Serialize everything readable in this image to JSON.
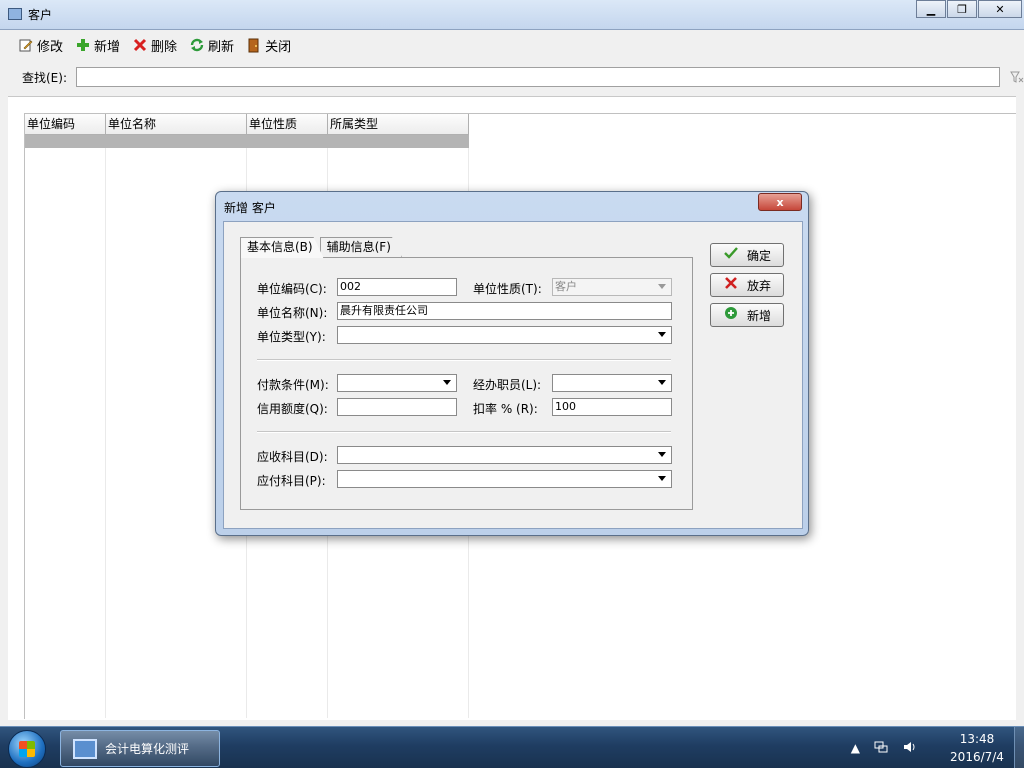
{
  "window": {
    "title": "客户",
    "min_label": "▁",
    "max_label": "❐",
    "close_label": "✕"
  },
  "toolbar": {
    "edit_label": "修改",
    "add_label": "新增",
    "delete_label": "删除",
    "refresh_label": "刷新",
    "close_label": "关闭"
  },
  "find": {
    "label": "查找(E):",
    "value": ""
  },
  "grid": {
    "columns": [
      "单位编码",
      "单位名称",
      "单位性质",
      "所属类型"
    ]
  },
  "dialog": {
    "title": "新增 客户",
    "close_label": "x",
    "tabs": [
      "基本信息(B)",
      "辅助信息(F)"
    ],
    "fields": {
      "code_label": "单位编码(C):",
      "code_value": "002",
      "nature_label": "单位性质(T):",
      "nature_value": "客户",
      "name_label": "单位名称(N):",
      "name_value": "晨升有限责任公司",
      "type_label": "单位类型(Y):",
      "type_value": "",
      "payment_label": "付款条件(M):",
      "payment_value": "",
      "staff_label": "经办职员(L):",
      "staff_value": "",
      "credit_label": "信用额度(Q):",
      "credit_value": "",
      "discount_label": "扣率 %   (R):",
      "discount_value": "100",
      "receivable_label": "应收科目(D):",
      "receivable_value": "",
      "payable_label": "应付科目(P):",
      "payable_value": ""
    },
    "buttons": {
      "ok_label": "确定",
      "cancel_label": "放弃",
      "new_label": "新增"
    }
  },
  "taskbar": {
    "app_label": "会计电算化测评",
    "time": "13:48",
    "date": "2016/7/4"
  },
  "colors": {
    "ok_icon": "#3a9a2a",
    "cancel_icon": "#d02020",
    "new_icon": "#2e9a3a"
  }
}
